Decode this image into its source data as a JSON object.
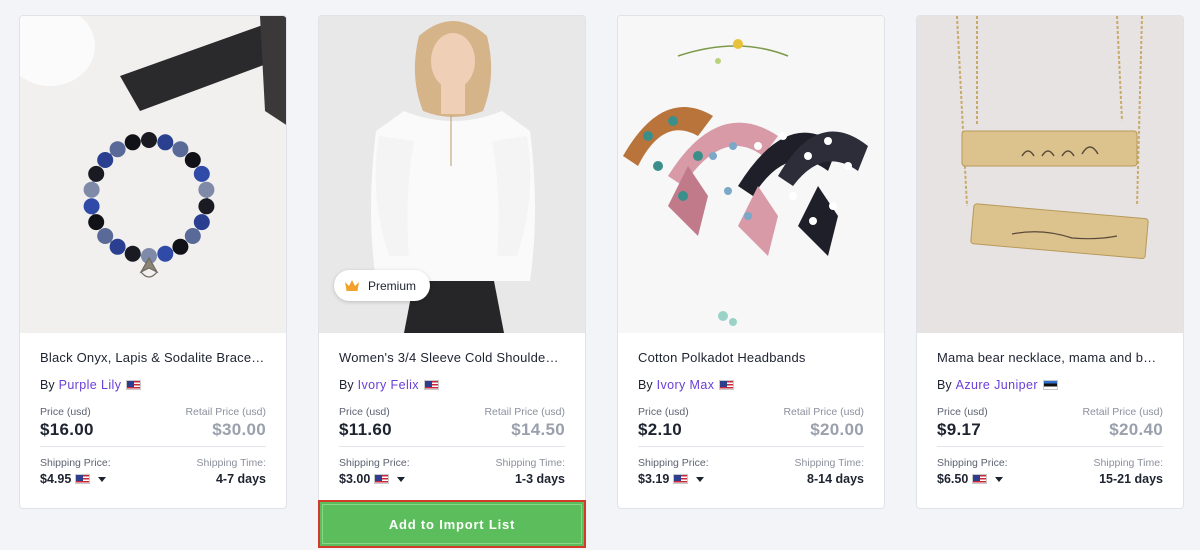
{
  "products": [
    {
      "title": "Black Onyx, Lapis & Sodalite Brace…",
      "by_label": "By",
      "seller": "Purple Lily",
      "seller_flag": "us-flag",
      "price_label": "Price (usd)",
      "price": "$16.00",
      "retail_label": "Retail Price (usd)",
      "retail": "$30.00",
      "shipping_label": "Shipping Price:",
      "shipping_price": "$4.95",
      "time_label": "Shipping Time:",
      "shipping_time": "4-7 days"
    },
    {
      "title": "Women's 3/4 Sleeve Cold Shoulde…",
      "by_label": "By",
      "seller": "Ivory Felix",
      "seller_flag": "us-flag",
      "badge": "Premium",
      "price_label": "Price (usd)",
      "price": "$11.60",
      "retail_label": "Retail Price (usd)",
      "retail": "$14.50",
      "shipping_label": "Shipping Price:",
      "shipping_price": "$3.00",
      "time_label": "Shipping Time:",
      "shipping_time": "1-3 days"
    },
    {
      "title": "Cotton Polkadot Headbands",
      "by_label": "By",
      "seller": "Ivory Max",
      "seller_flag": "us-flag",
      "price_label": "Price (usd)",
      "price": "$2.10",
      "retail_label": "Retail Price (usd)",
      "retail": "$20.00",
      "shipping_label": "Shipping Price:",
      "shipping_price": "$3.19",
      "time_label": "Shipping Time:",
      "shipping_time": "8-14 days"
    },
    {
      "title": "Mama bear necklace, mama and b…",
      "by_label": "By",
      "seller": "Azure Juniper",
      "seller_flag": "estonia-flag",
      "price_label": "Price (usd)",
      "price": "$9.17",
      "retail_label": "Retail Price (usd)",
      "retail": "$20.40",
      "shipping_label": "Shipping Price:",
      "shipping_price": "$6.50",
      "time_label": "Shipping Time:",
      "shipping_time": "15-21 days"
    }
  ],
  "import_button_label": "Add to Import List",
  "colors": {
    "accent_seller": "#6a3fd6",
    "button_green": "#5cbd5c",
    "highlight_red": "#d23b2a",
    "background": "#f3f4f8"
  }
}
